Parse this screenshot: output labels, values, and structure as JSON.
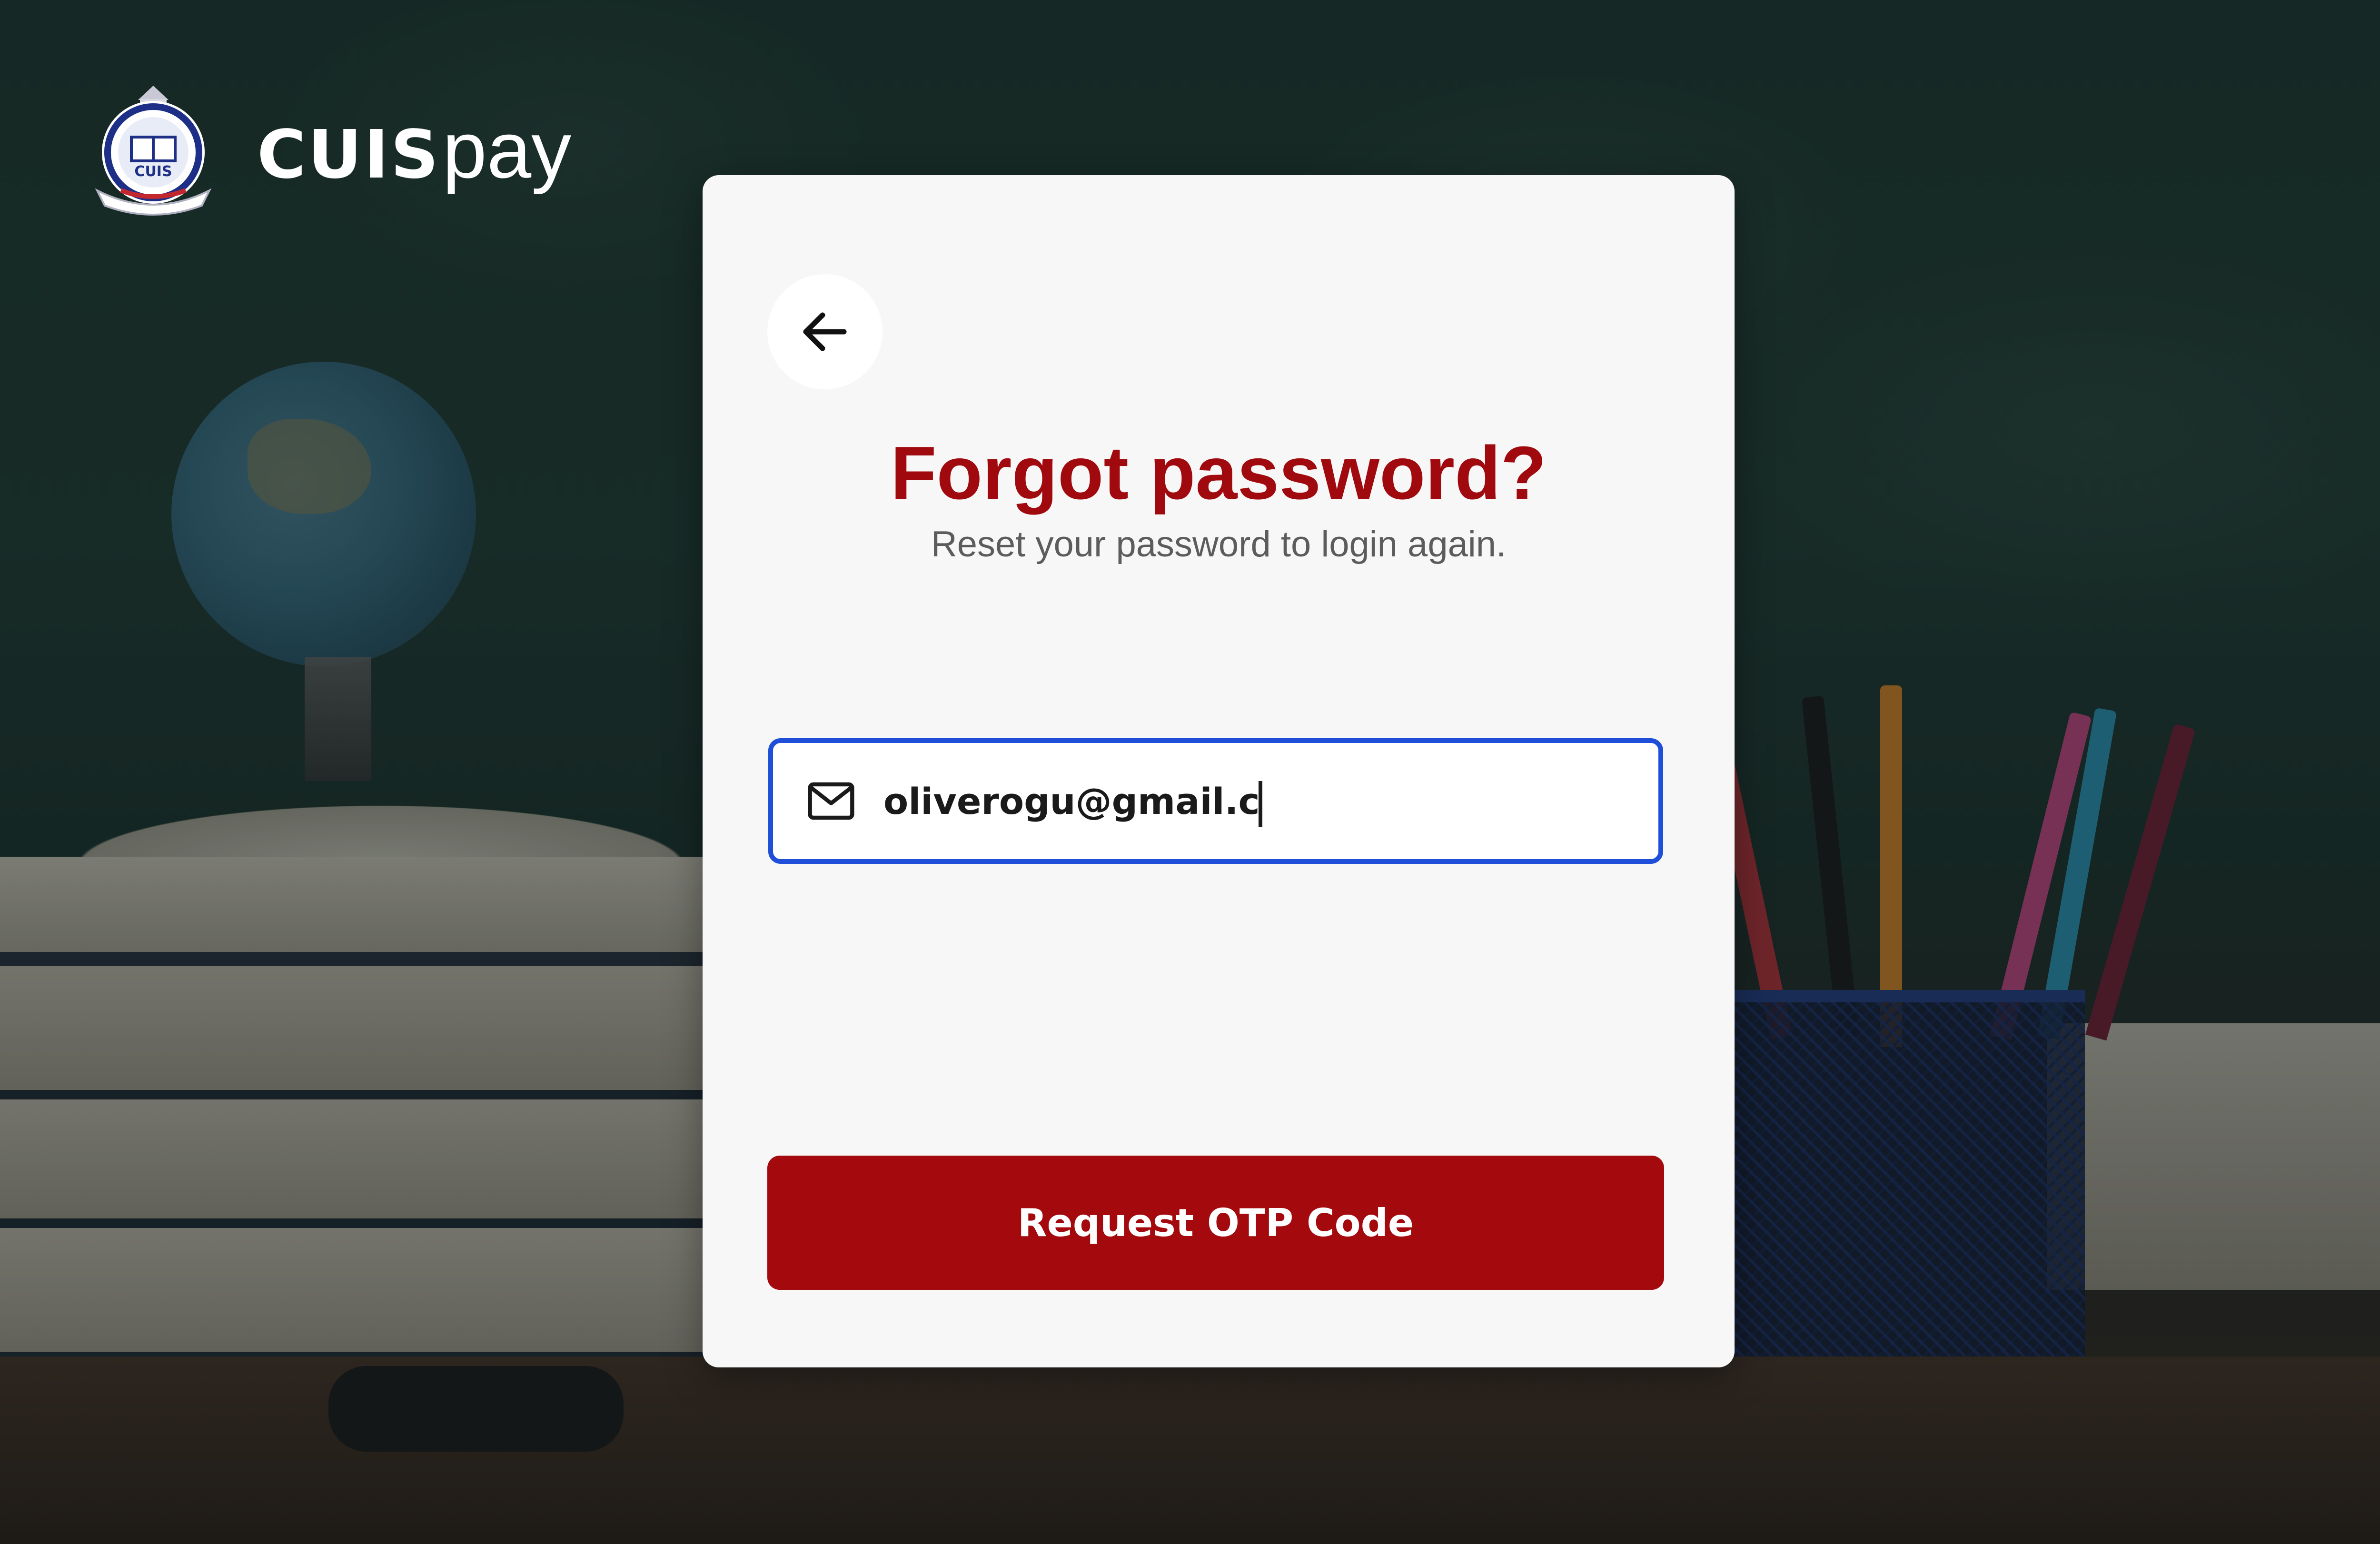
{
  "brand": {
    "name_strong": "CUIS",
    "name_light": "pay",
    "logo_icon": "school-crest-icon",
    "crest_text": "CUIS"
  },
  "form": {
    "back_icon": "arrow-left-icon",
    "title": "Forgot password?",
    "subtitle": "Reset your password to login again.",
    "email": {
      "icon": "mail-icon",
      "value": "oliverogu@gmail.c",
      "focused": true
    },
    "submit_label": "Request OTP Code"
  },
  "colors": {
    "accent": "#a3090d",
    "focus_border": "#1f4fd8",
    "card_background": "#f7f7f7",
    "subtitle": "#5c5c5c"
  }
}
